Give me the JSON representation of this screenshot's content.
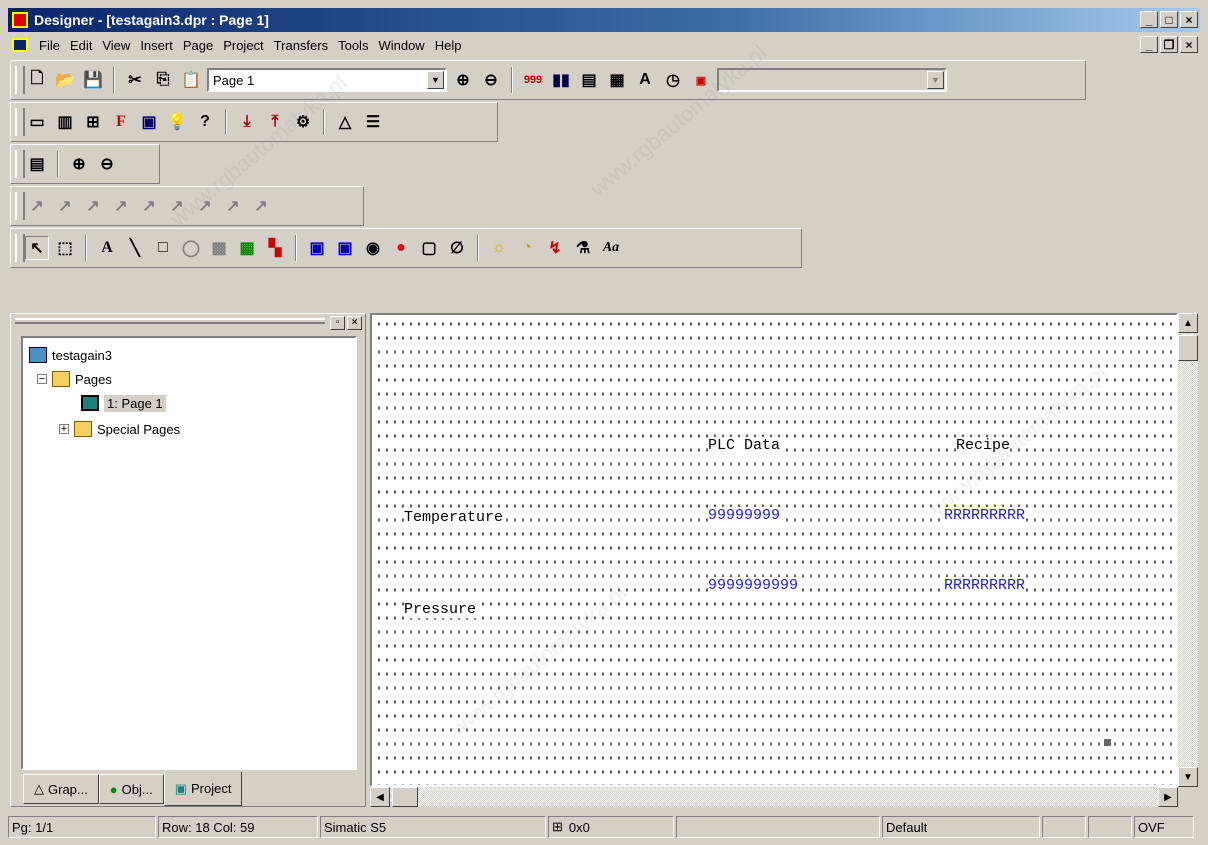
{
  "window": {
    "title": "Designer - [testagain3.dpr : Page 1]"
  },
  "menu": [
    "File",
    "Edit",
    "View",
    "Insert",
    "Page",
    "Project",
    "Transfers",
    "Tools",
    "Window",
    "Help"
  ],
  "toolbar": {
    "page_combo": "Page 1"
  },
  "tree": {
    "root": "testagain3",
    "pages": "Pages",
    "page1": "1: Page 1",
    "special": "Special Pages"
  },
  "tabs": [
    "Grap...",
    "Obj...",
    "Project"
  ],
  "canvas": {
    "plc_header": "PLC Data",
    "recipe_header": "Recipe",
    "temperature": "Temperature",
    "pressure": "Pressure",
    "temp_plc": "99999999",
    "temp_recipe": "RRRRRRRRR",
    "press_plc": "9999999999",
    "press_recipe": "RRRRRRRRR"
  },
  "status": {
    "page": "Pg: 1/1",
    "rowcol": "Row: 18  Col: 59",
    "protocol": "Simatic S5",
    "size": "0x0",
    "font": "Default",
    "ovf": "OVF"
  },
  "watermark": "www.rgbautomatyka.pl"
}
